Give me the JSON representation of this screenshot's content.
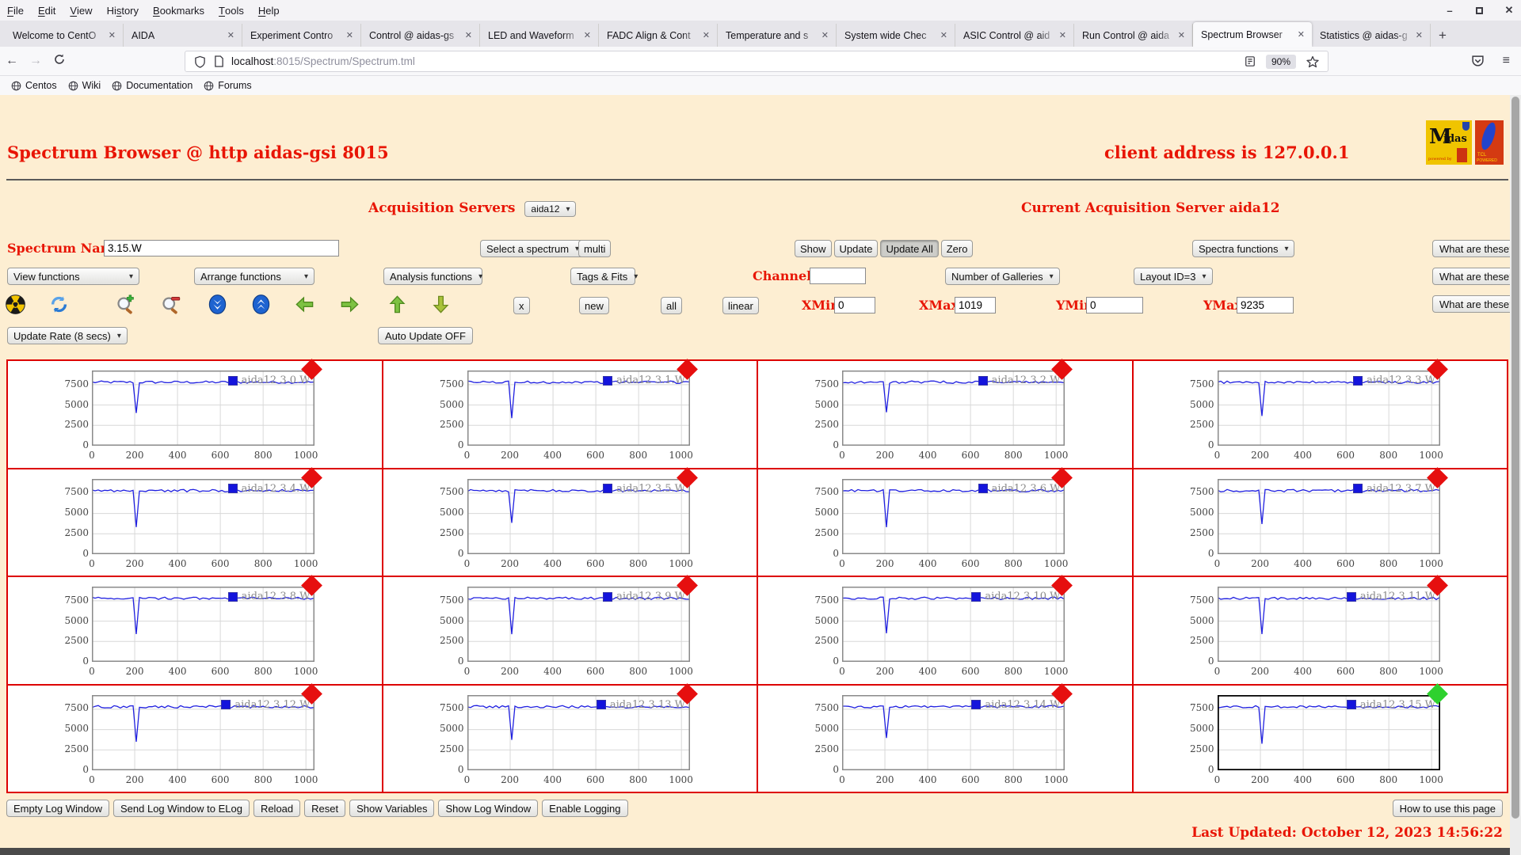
{
  "window": {
    "minimize": "–",
    "maximize": "",
    "close": "✕"
  },
  "menu_bar": {
    "items": [
      {
        "label": "File",
        "accel": 0
      },
      {
        "label": "Edit",
        "accel": 0
      },
      {
        "label": "View",
        "accel": 0
      },
      {
        "label": "History",
        "accel": 2
      },
      {
        "label": "Bookmarks",
        "accel": 0
      },
      {
        "label": "Tools",
        "accel": 0
      },
      {
        "label": "Help",
        "accel": 0
      }
    ]
  },
  "tab_bar": {
    "tabs": [
      "Welcome to CentO",
      "AIDA",
      "Experiment Contro",
      "Control @ aidas-gs",
      "LED and Waveform",
      "FADC Align & Cont",
      "Temperature and s",
      "System wide Chec",
      "ASIC Control @ aid",
      "Run Control @ aida",
      "Spectrum Browser",
      "Statistics @ aidas-g"
    ],
    "active_index": 10,
    "close_glyph": "✕",
    "new_tab_label": "+"
  },
  "nav_bar": {
    "back": "←",
    "forward": "→",
    "url_host": "localhost",
    "url_rest": ":8015/Spectrum/Spectrum.tml",
    "zoom_badge": "90%"
  },
  "bookmarks_bar": {
    "items": [
      "Centos",
      "Wiki",
      "Documentation",
      "Forums"
    ]
  },
  "page": {
    "title": "Spectrum Browser @ http aidas-gsi 8015",
    "client_address": "client address is 127.0.0.1",
    "acquisition_servers_label": "Acquisition Servers",
    "acquisition_server_value": "aida12",
    "current_server_text": "Current Acquisition Server aida12",
    "spectrum_name_label": "Spectrum Name:",
    "spectrum_name_value": "3.15.W",
    "select_spectrum_label": "Select a spectrum",
    "multi_label": "multi",
    "show_buttons": [
      "Show",
      "Update",
      "Update All",
      "Zero"
    ],
    "pressed_button": "Update All",
    "spectra_functions_label": "Spectra functions",
    "what_are_these": "What are these?",
    "function_dropdowns": [
      "View functions",
      "Arrange functions",
      "Analysis functions",
      "Tags & Fits"
    ],
    "channel_label": "Channel:",
    "channel_value": "",
    "galleries_label": "Number of Galleries",
    "layout_label": "Layout ID=3",
    "toolbar_icons": [
      "radiation-icon",
      "refresh-icon",
      "zoom-in-icon",
      "zoom-out-icon",
      "scroll-down-icon",
      "scroll-up-icon",
      "arrow-left-icon",
      "arrow-right-icon",
      "arrow-up-icon",
      "arrow-down-icon"
    ],
    "small_buttons": [
      "x",
      "new",
      "all",
      "linear"
    ],
    "axis_fields": [
      {
        "label": "XMin",
        "value": "0"
      },
      {
        "label": "XMax",
        "value": "1019"
      },
      {
        "label": "YMin",
        "value": "0"
      },
      {
        "label": "YMax",
        "value": "9235"
      }
    ],
    "update_rate_label": "Update Rate (8 secs)",
    "auto_update_label": "Auto Update OFF",
    "log_buttons": [
      "Empty Log Window",
      "Send Log Window to ELog",
      "Reload",
      "Reset",
      "Show Variables",
      "Show Log Window",
      "Enable Logging"
    ],
    "help_button": "How to use this page",
    "last_updated": "Last Updated: October 12, 2023 14:56:22",
    "colors": {
      "accent_red": "#e81505",
      "page_bg": "#fdeed2",
      "grid_border": "#dd0000",
      "line_blue": "#2020e0",
      "marker_red": "#e60f0f",
      "marker_green": "#2ed12e"
    }
  },
  "chart_data": {
    "type": "line",
    "x_ticks": [
      0,
      200,
      400,
      600,
      800,
      1000
    ],
    "y_ticks": [
      0,
      2500,
      5000,
      7500
    ],
    "xlim": [
      0,
      1019
    ],
    "ylim": [
      0,
      9235
    ],
    "baseline": 7800,
    "dip_x": 200,
    "dip_y": 3700,
    "grid": true,
    "legend_position": "top-right",
    "spectra": [
      {
        "name": "aida12 3.0.W",
        "marker": "red",
        "selected": false
      },
      {
        "name": "aida12 3.1.W",
        "marker": "red",
        "selected": false
      },
      {
        "name": "aida12 3.2.W",
        "marker": "red",
        "selected": false
      },
      {
        "name": "aida12 3.3.W",
        "marker": "red",
        "selected": false
      },
      {
        "name": "aida12 3.4.W",
        "marker": "red",
        "selected": false
      },
      {
        "name": "aida12 3.5.W",
        "marker": "red",
        "selected": false
      },
      {
        "name": "aida12 3.6.W",
        "marker": "red",
        "selected": false
      },
      {
        "name": "aida12 3.7.W",
        "marker": "red",
        "selected": false
      },
      {
        "name": "aida12 3.8.W",
        "marker": "red",
        "selected": false
      },
      {
        "name": "aida12 3.9.W",
        "marker": "red",
        "selected": false
      },
      {
        "name": "aida12 3.10.W",
        "marker": "red",
        "selected": false
      },
      {
        "name": "aida12 3.11.W",
        "marker": "red",
        "selected": false
      },
      {
        "name": "aida12 3.12.W",
        "marker": "red",
        "selected": false
      },
      {
        "name": "aida12 3.13.W",
        "marker": "red",
        "selected": false
      },
      {
        "name": "aida12 3.14.W",
        "marker": "red",
        "selected": false
      },
      {
        "name": "aida12 3.15.W",
        "marker": "green",
        "selected": true
      }
    ]
  }
}
